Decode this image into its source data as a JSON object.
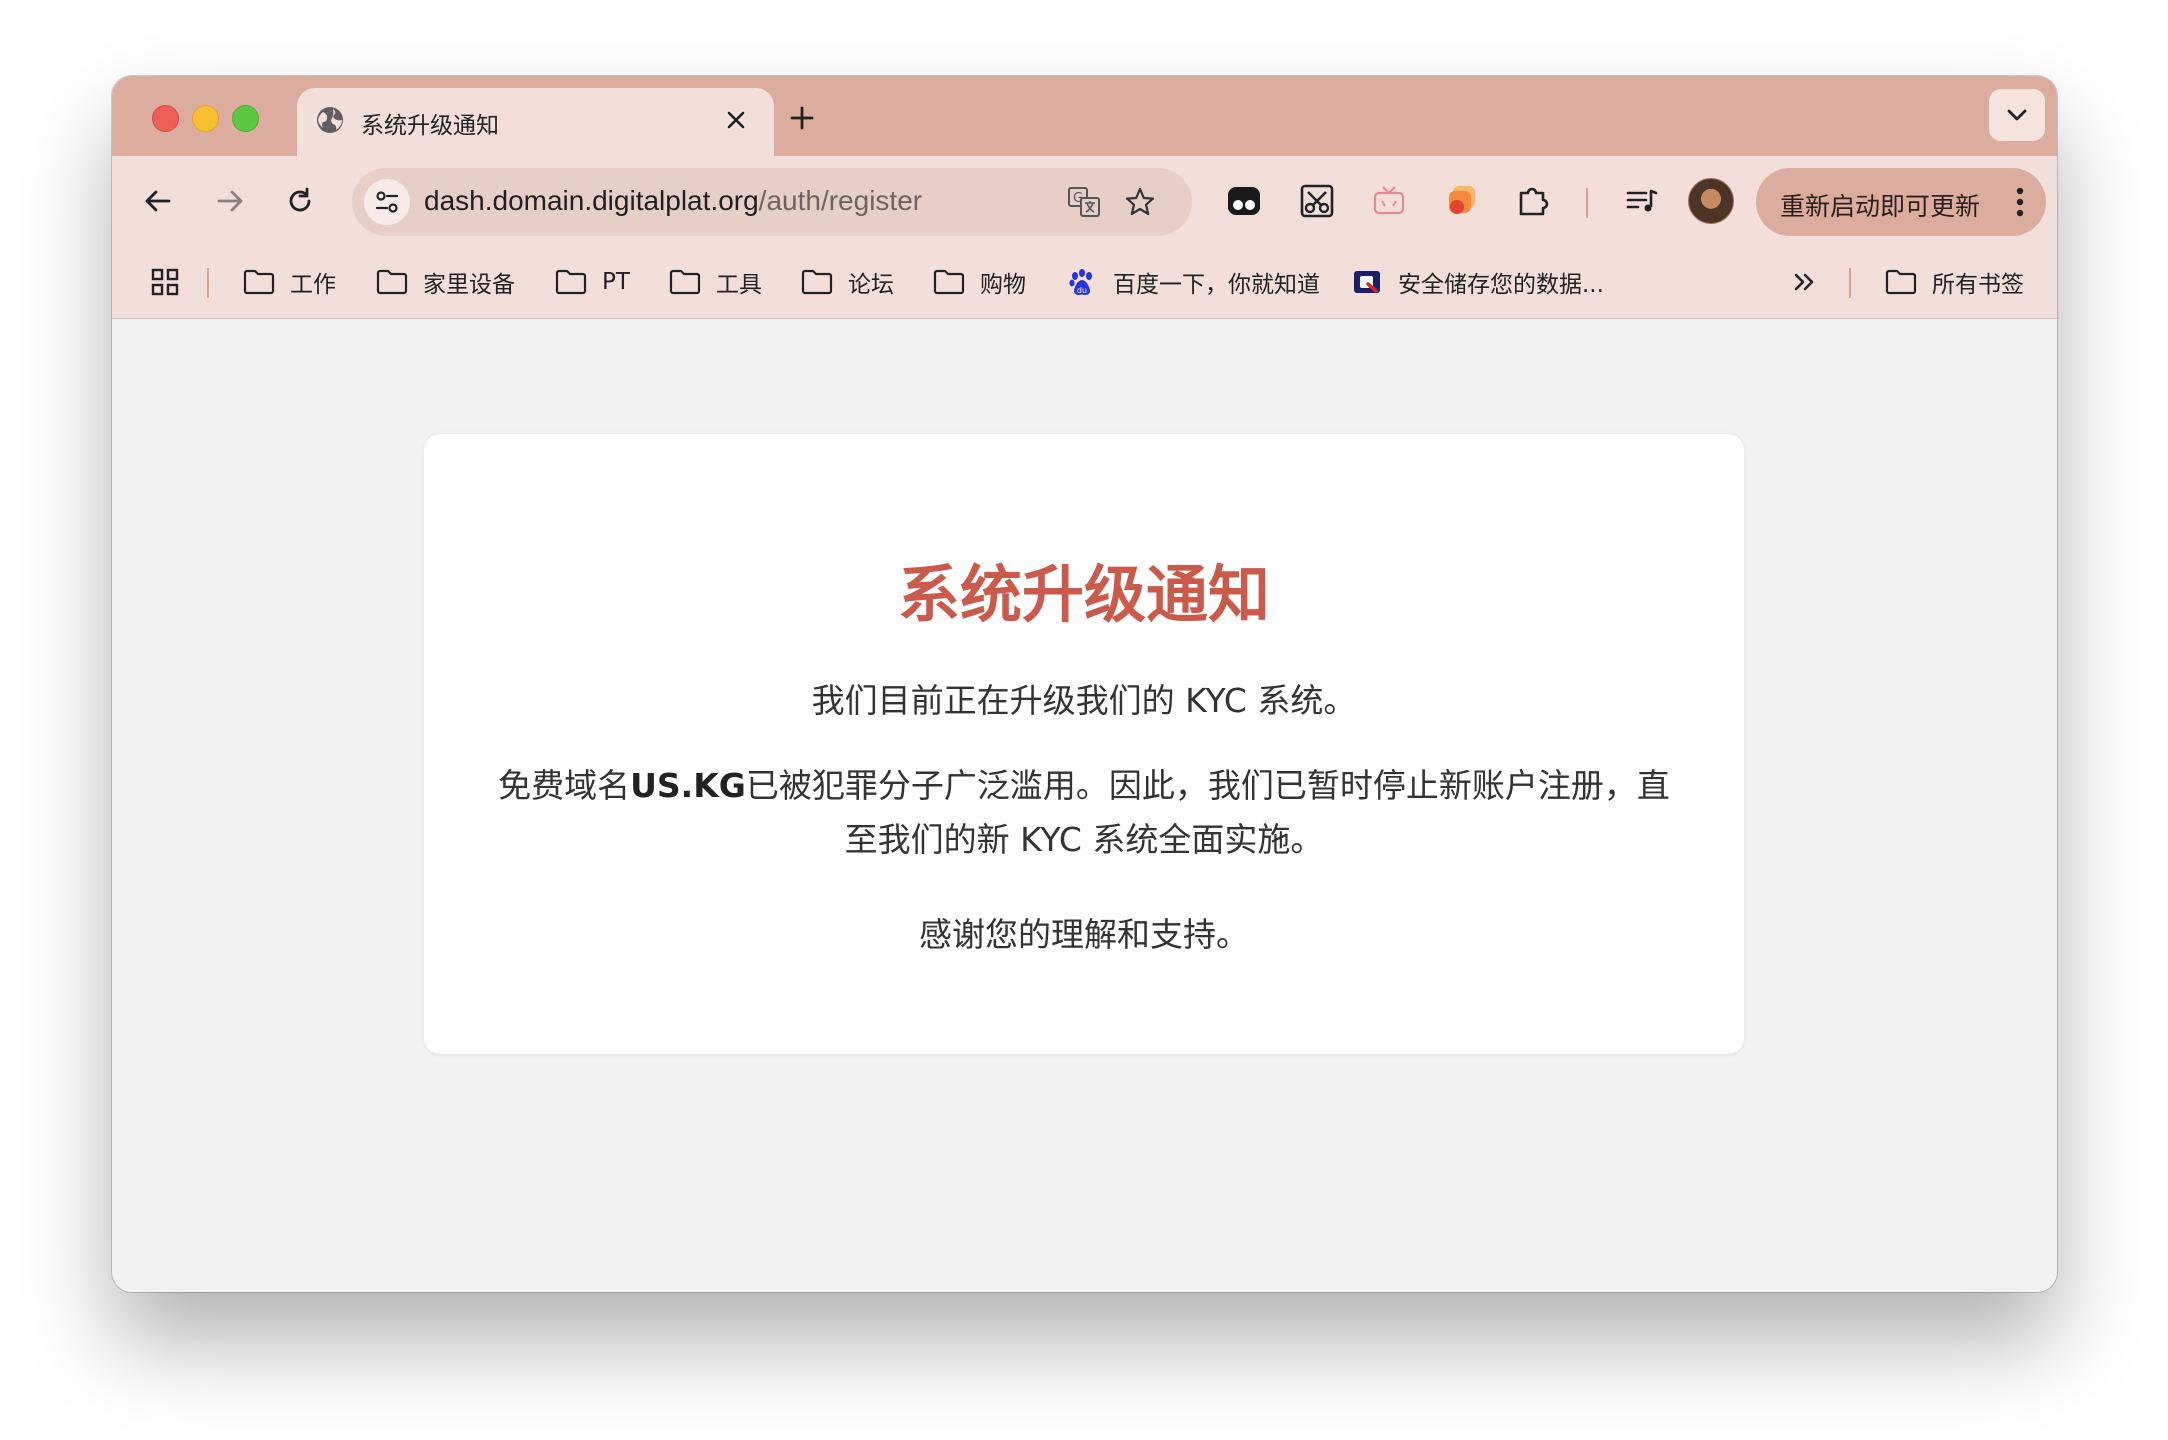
{
  "tab": {
    "title": "系统升级通知"
  },
  "address_bar": {
    "host": "dash.domain.digitalplat.org",
    "path": "/auth/register"
  },
  "toolbar": {
    "update_label": "重新启动即可更新"
  },
  "bookmarks": {
    "items": [
      {
        "label": "工作",
        "icon": "folder-icon"
      },
      {
        "label": "家里设备",
        "icon": "folder-icon"
      },
      {
        "label": "PT",
        "icon": "folder-icon"
      },
      {
        "label": "工具",
        "icon": "folder-icon"
      },
      {
        "label": "论坛",
        "icon": "folder-icon"
      },
      {
        "label": "购物",
        "icon": "folder-icon"
      },
      {
        "label": "百度一下，你就知道",
        "icon": "baidu-icon"
      },
      {
        "label": "安全储存您的数据...",
        "icon": "site-favicon"
      }
    ],
    "overflow_label": "»",
    "all_bookmarks_label": "所有书签"
  },
  "notice": {
    "heading": "系统升级通知",
    "line1": "我们目前正在升级我们的 KYC 系统。",
    "line2_before": "免费域名",
    "line2_bold": "US.KG",
    "line2_after": "已被犯罪分子广泛滥用。因此，我们已暂时停止新账户注册，直至我们的新 KYC 系统全面实施。",
    "line3": "感谢您的理解和支持。"
  },
  "colors": {
    "tabstrip": "#dcad9e",
    "toolbar": "#f2dfd9",
    "heading": "#cb5a4b",
    "page_bg": "#f2f2f2"
  }
}
